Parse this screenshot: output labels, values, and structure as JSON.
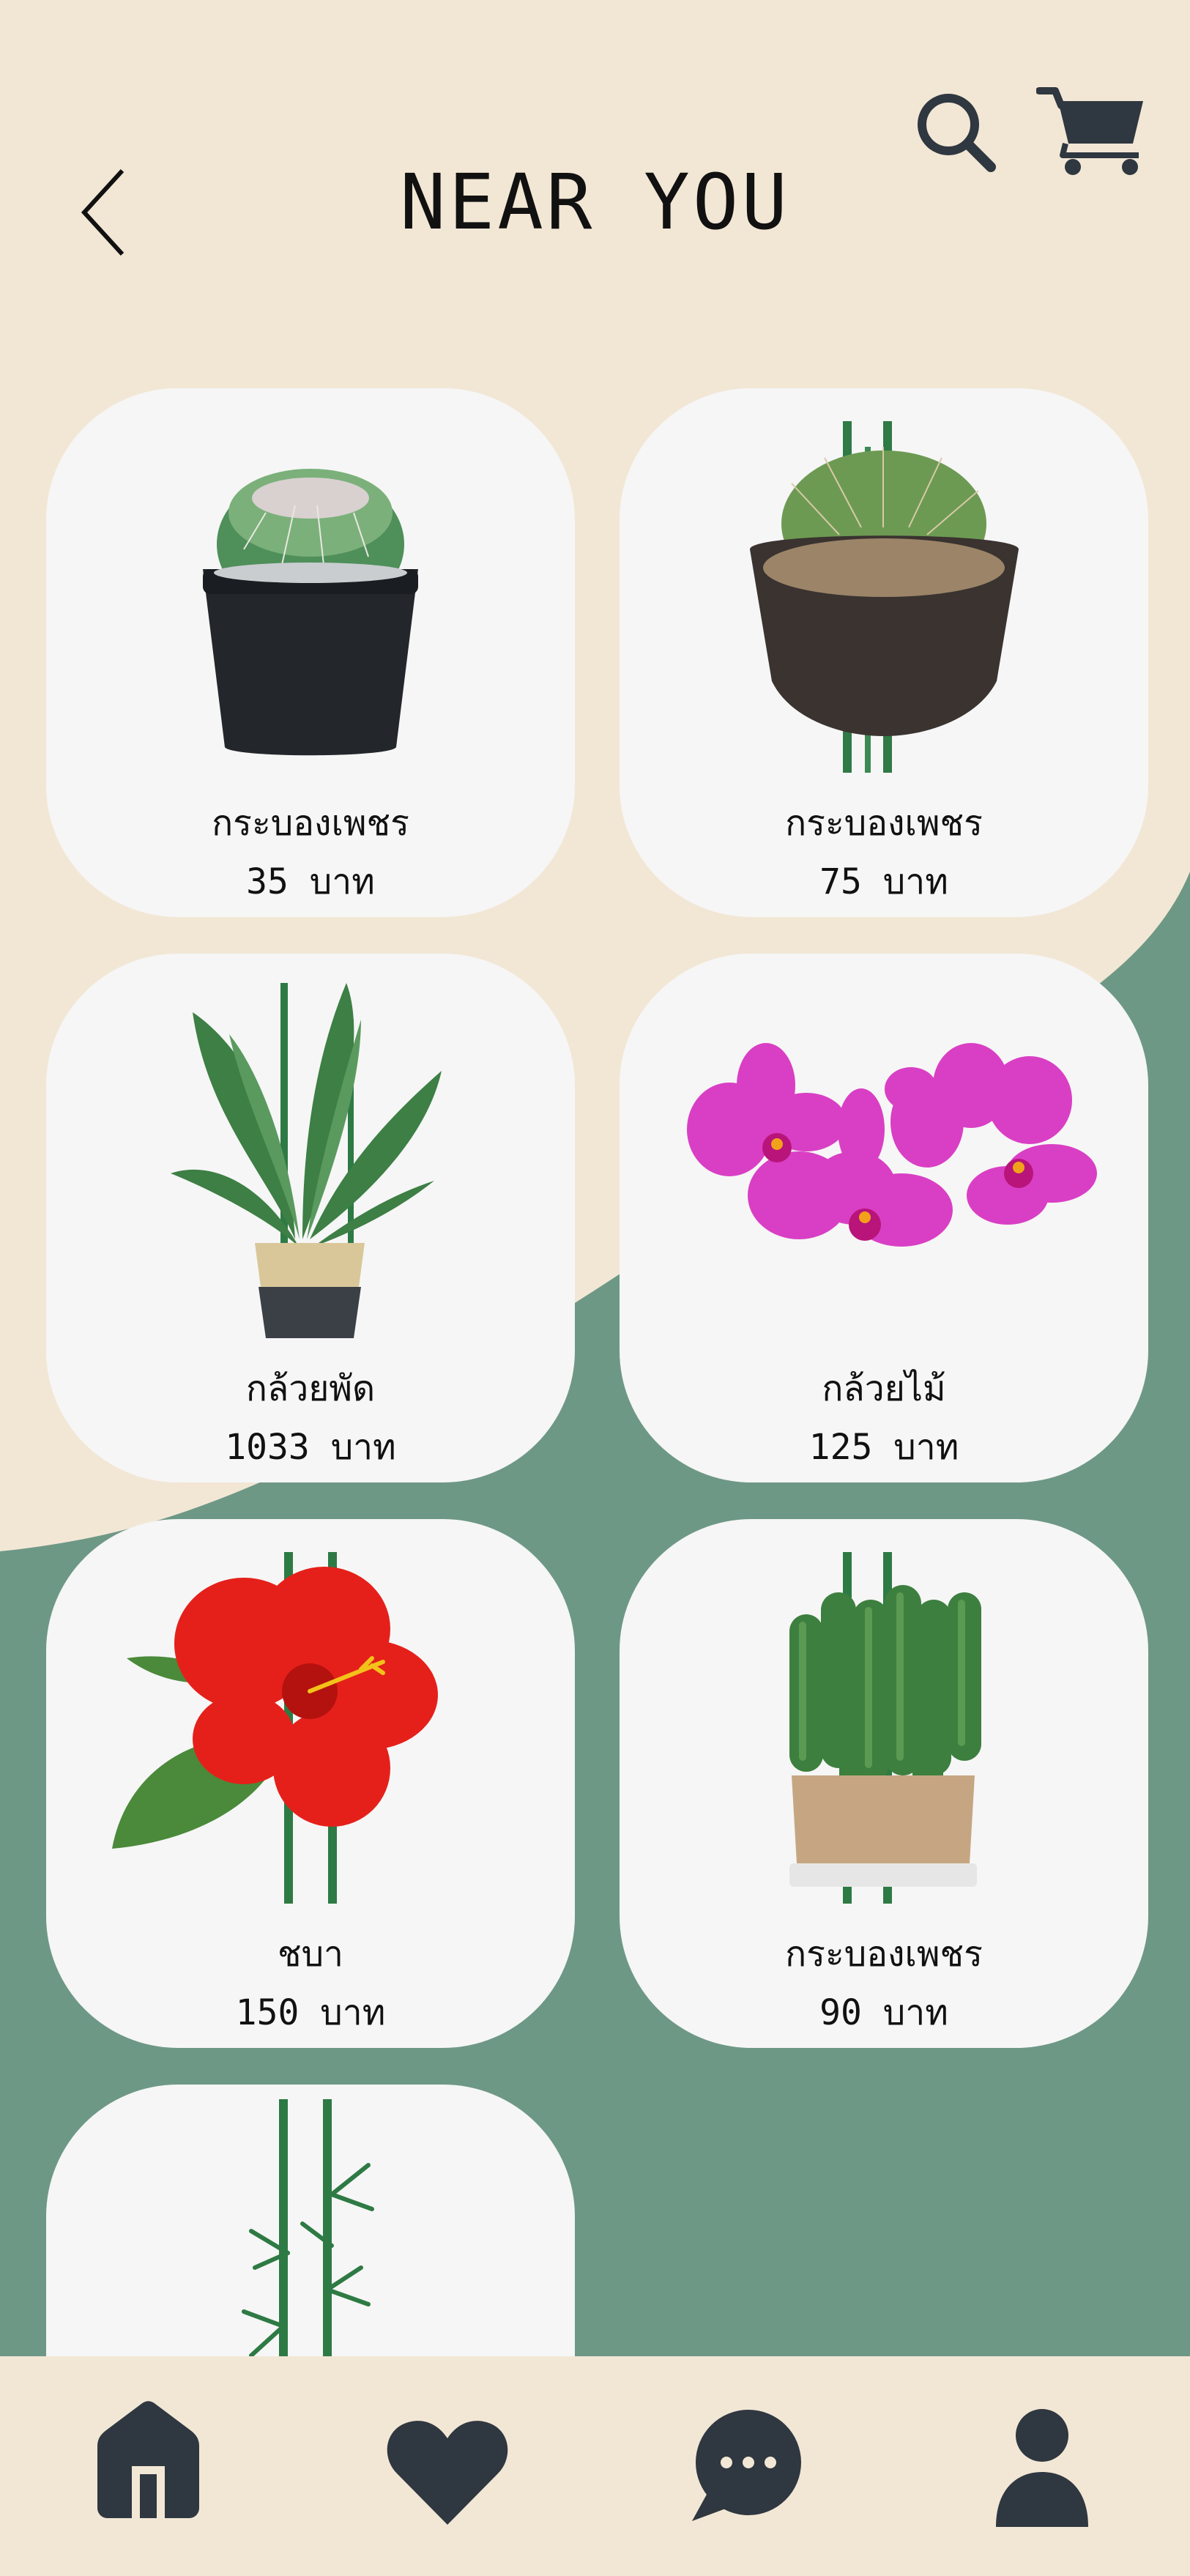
{
  "header": {
    "title": "NEAR YOU"
  },
  "icons": {
    "back": "chevron-left-icon",
    "search": "search-icon",
    "cart": "cart-icon",
    "home": "home-icon",
    "favorites": "heart-icon",
    "chat": "chat-icon",
    "profile": "user-icon"
  },
  "colors": {
    "cream": "#f2e7d5",
    "sage": "#6e9886",
    "card": "#f6f6f6",
    "icon": "#2f3740"
  },
  "products": [
    {
      "name": "กระบองเพชร",
      "price": "35 บาท",
      "image": "cactus-black-pot"
    },
    {
      "name": "กระบองเพชร",
      "price": "75 บาท",
      "image": "cactus-brown-pot"
    },
    {
      "name": "กล้วยพัด",
      "price": "1033 บาท",
      "image": "bird-of-paradise-basket"
    },
    {
      "name": "กล้วยไม้",
      "price": "125 บาท",
      "image": "pink-orchids"
    },
    {
      "name": "ชบา",
      "price": "150 บาท",
      "image": "red-hibiscus"
    },
    {
      "name": "กระบองเพชร",
      "price": "90 บาท",
      "image": "cactus-white-pot"
    },
    {
      "name": "",
      "price": "",
      "image": "bamboo"
    }
  ]
}
